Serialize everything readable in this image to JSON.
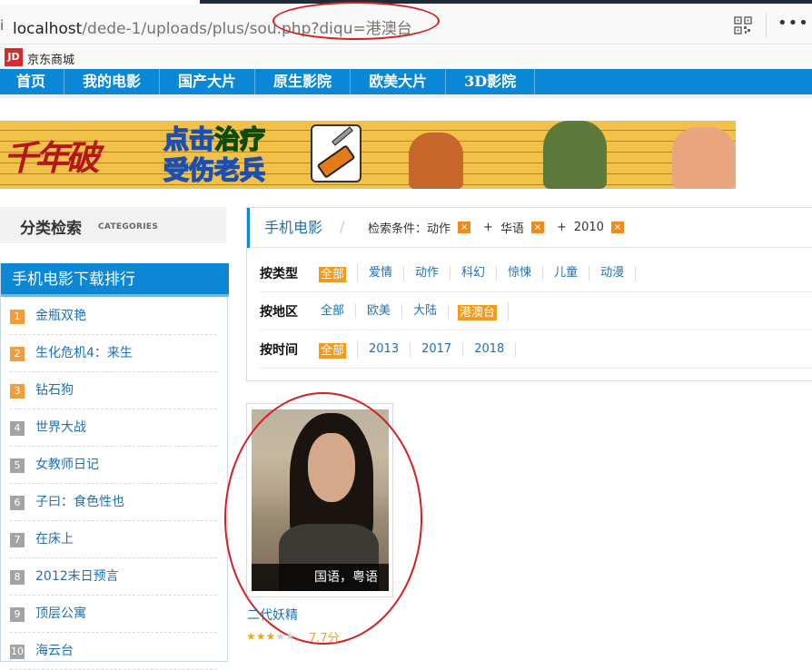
{
  "browser": {
    "url_host": "localhost",
    "url_path": "/dede-1/uploads/plus/sou.php?diqu=港澳台",
    "bookmark": "京东商城",
    "bookmark_logo": "JD",
    "menu_glyph": "•••"
  },
  "nav": {
    "items": [
      "首页",
      "我的电影",
      "国产大片",
      "原生影院",
      "欧美大片",
      "3D影院"
    ]
  },
  "banner": {
    "brand": "千年破",
    "promo_line1_a": "点击",
    "promo_line1_b": "治疗",
    "promo_line2": "受伤老兵"
  },
  "sidebar": {
    "category_title": "分类检索",
    "category_en": "CATEGORIES",
    "ranking_title": "手机电影下载排行",
    "ranking": [
      {
        "num": "1",
        "title": "金瓶双艳"
      },
      {
        "num": "2",
        "title": "生化危机4：来生"
      },
      {
        "num": "3",
        "title": "钻石狗"
      },
      {
        "num": "4",
        "title": "世界大战"
      },
      {
        "num": "5",
        "title": "女教师日记"
      },
      {
        "num": "6",
        "title": "子曰：食色性也"
      },
      {
        "num": "7",
        "title": "在床上"
      },
      {
        "num": "8",
        "title": "2012末日预言"
      },
      {
        "num": "9",
        "title": "顶层公寓"
      },
      {
        "num": "10",
        "title": "海云台"
      }
    ]
  },
  "filter": {
    "title": "手机电影",
    "cond_label": "检索条件：",
    "conditions": [
      "动作",
      "华语",
      "2010"
    ],
    "close_glyph": "×",
    "plus": "+",
    "rows": {
      "type": {
        "label": "按类型",
        "selected": "全部",
        "options": [
          "爱情",
          "动作",
          "科幻",
          "惊悚",
          "儿童",
          "动漫"
        ]
      },
      "region": {
        "label": "按地区",
        "options_before": [
          "全部",
          "欧美",
          "大陆"
        ],
        "selected": "港澳台"
      },
      "time": {
        "label": "按时间",
        "selected": "全部",
        "options": [
          "2013",
          "2017",
          "2018"
        ]
      }
    }
  },
  "movie": {
    "caption": "国语，粤语",
    "title": "二代妖精",
    "score": "7.7分",
    "rating_stars": 3,
    "rating_max": 5
  },
  "colors": {
    "nav_blue": "#0a87d6",
    "link_blue": "#1f6fb2",
    "orange": "#f19a1b",
    "annotation_red": "#d42020"
  }
}
